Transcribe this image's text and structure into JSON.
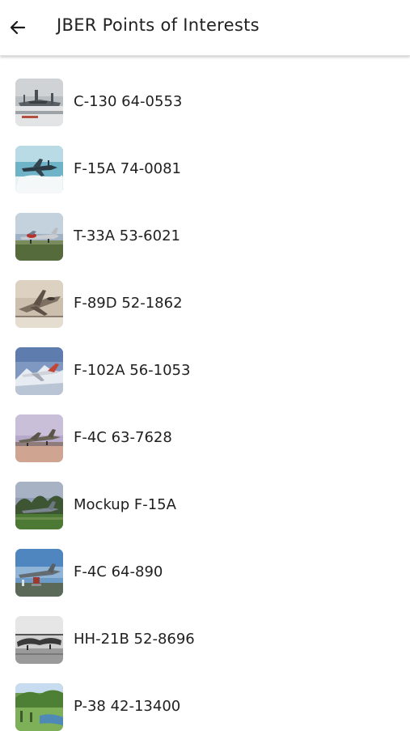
{
  "header": {
    "title": "JBER Points of Interests",
    "back_icon": "arrow-left-icon"
  },
  "items": [
    {
      "label": "C-130 64-0553",
      "photo": "C-130 aircraft on display in winter"
    },
    {
      "label": "F-15A 74-0081",
      "photo": "F-15A jet over icy water"
    },
    {
      "label": "T-33A 53-6021",
      "photo": "T-33A jet on grass"
    },
    {
      "label": "F-89D 52-1862",
      "photo": "F-89D jet in sepia"
    },
    {
      "label": "F-102A 56-1053",
      "photo": "F-102A jet with mountains"
    },
    {
      "label": "F-4C 63-7628",
      "photo": "F-4C jet on pavement"
    },
    {
      "label": "Mockup F-15A",
      "photo": "F-15A mockup by trees"
    },
    {
      "label": "F-4C 64-890",
      "photo": "F-4C jet on pedestal"
    },
    {
      "label": "HH-21B 52-8696",
      "photo": "HH-21B helicopter in black and white"
    },
    {
      "label": "P-38 42-13400",
      "photo": "P-38 site with green hills"
    }
  ]
}
